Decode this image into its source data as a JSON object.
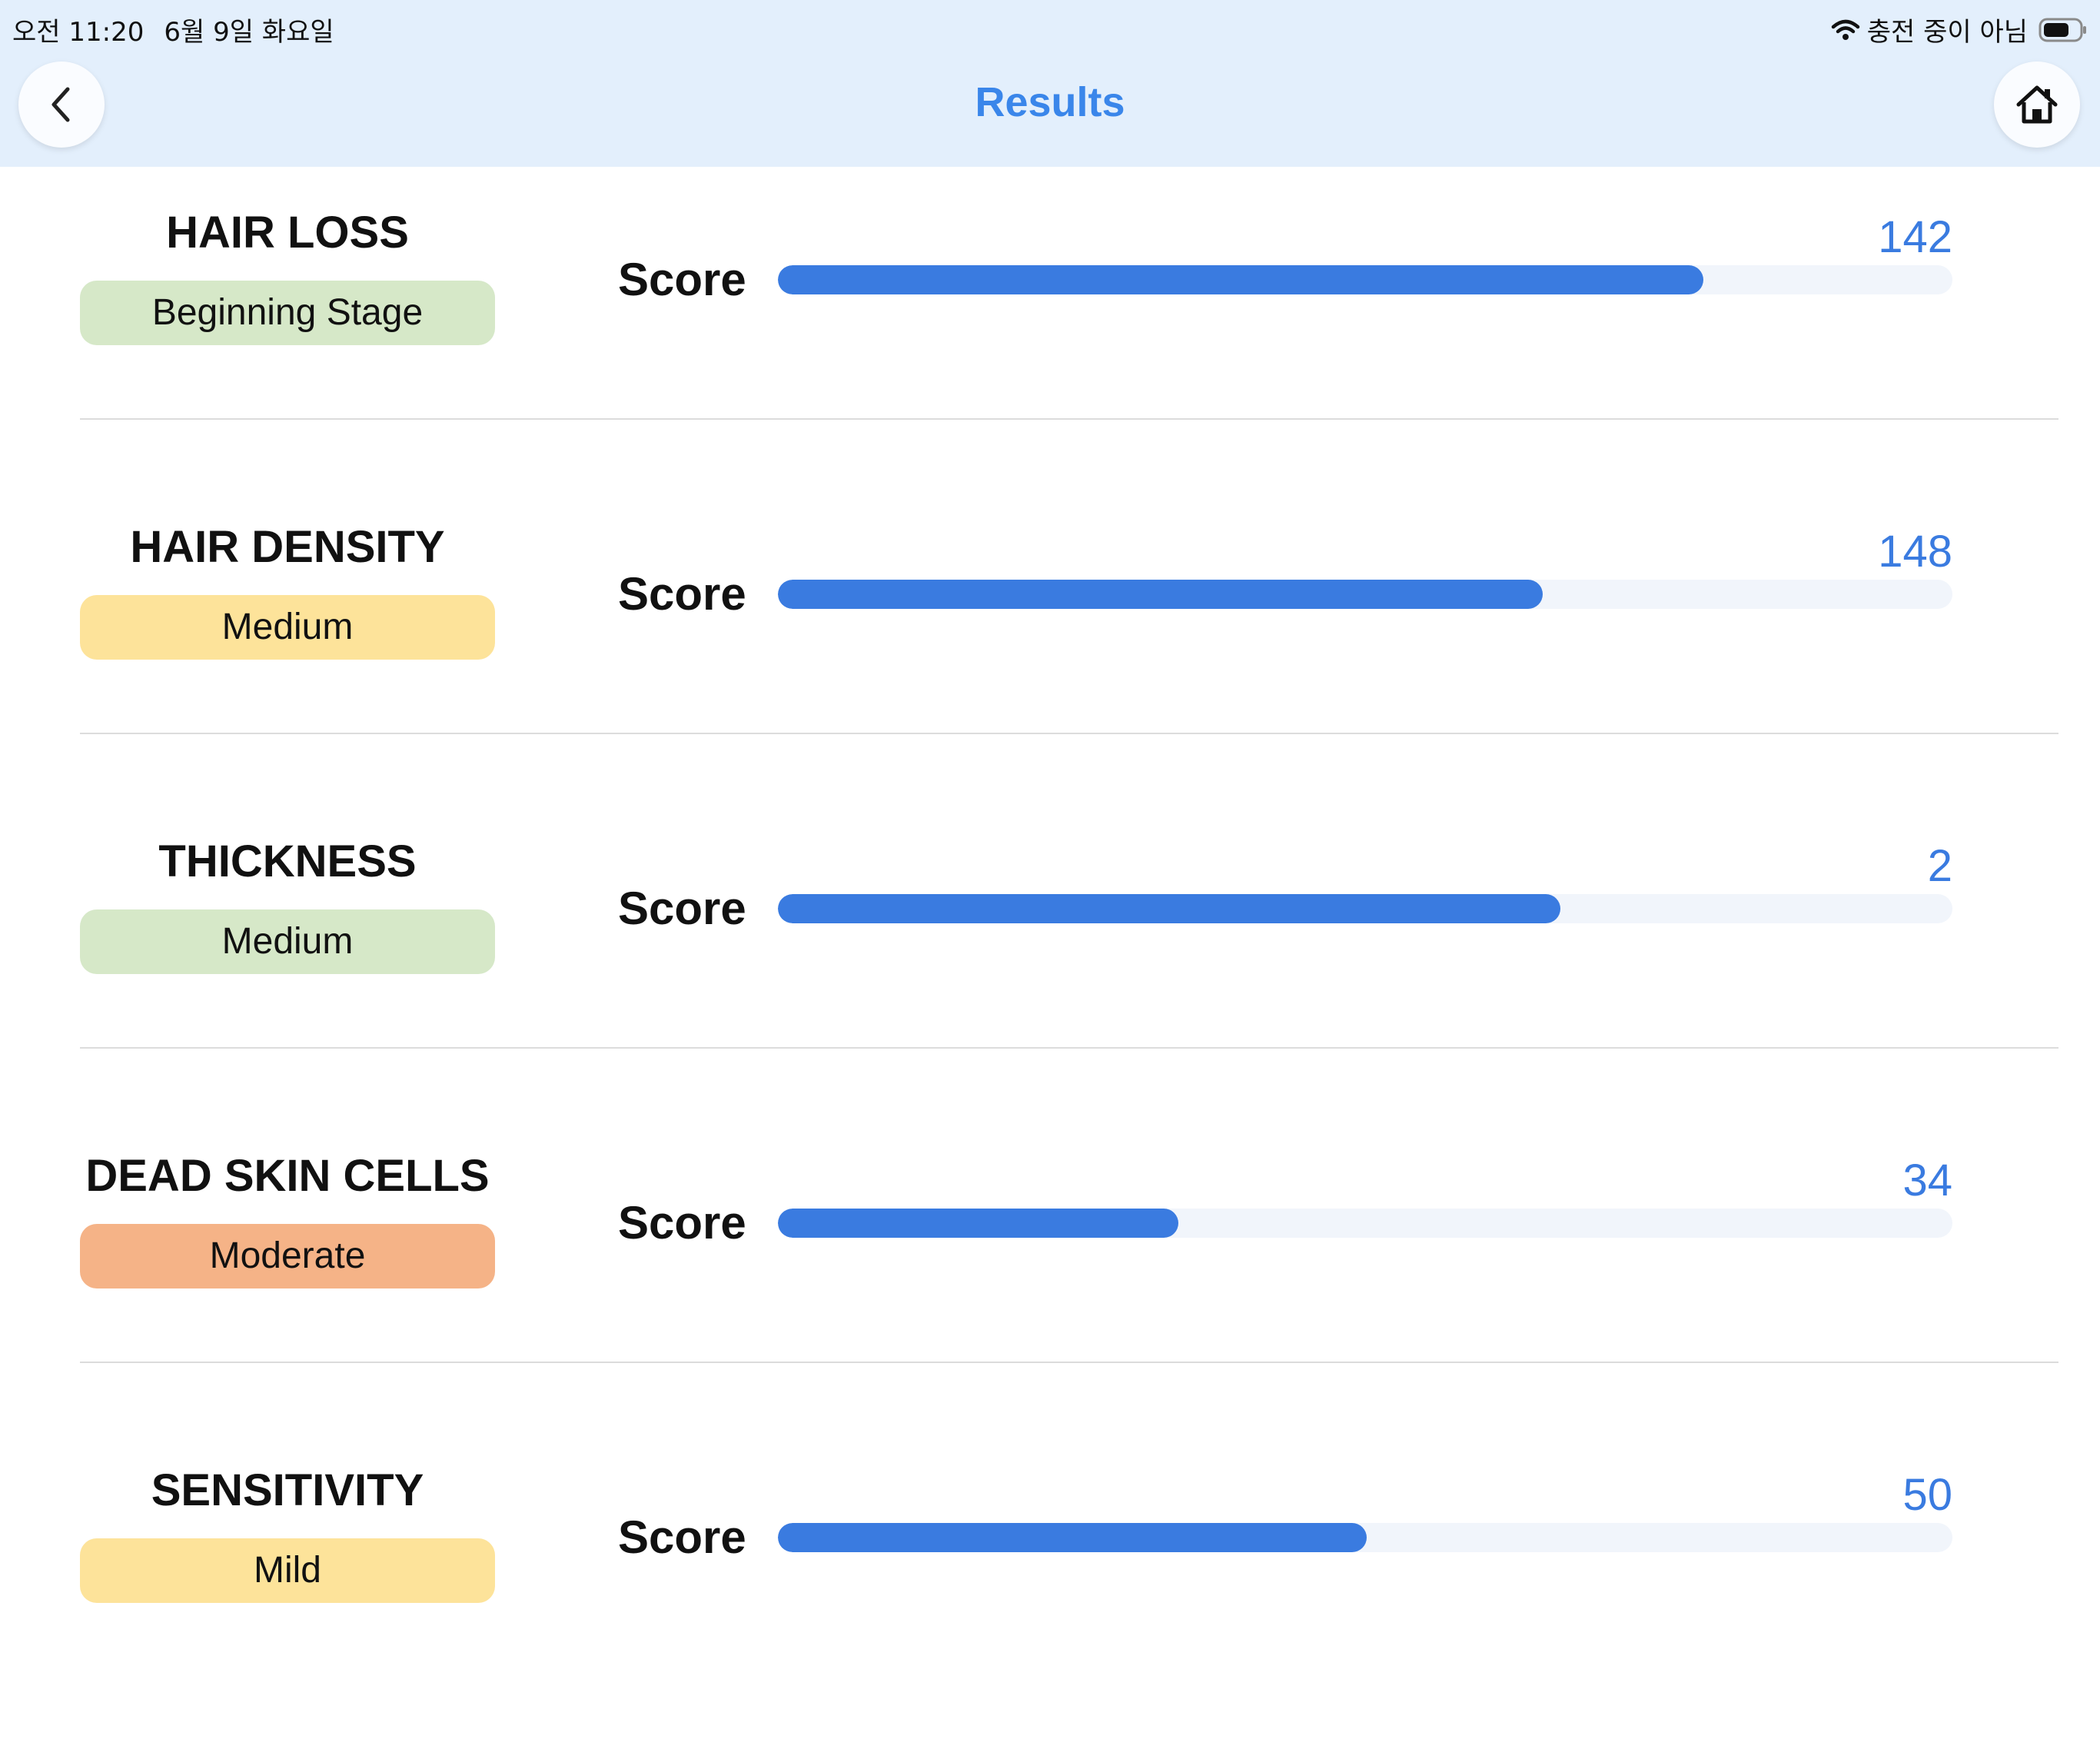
{
  "status_bar": {
    "time": "오전 11:20",
    "date": "6월 9일 화요일",
    "charging": "충전 중이 아님"
  },
  "header": {
    "title": "Results",
    "back_icon": "chevron-left-icon",
    "home_icon": "home-icon"
  },
  "colors": {
    "accent": "#3a7be0",
    "title": "#3a86ea",
    "header_bg": "#e3effc",
    "badge_green": "#d6e8c8",
    "badge_yellow": "#fde39a",
    "badge_orange": "#f5b387"
  },
  "results": [
    {
      "name": "HAIR LOSS",
      "status": "Beginning Stage",
      "badge_color": "#d6e8c8",
      "score_label": "Score",
      "score": "142",
      "fill_fraction": 0.788
    },
    {
      "name": "HAIR DENSITY",
      "status": "Medium",
      "badge_color": "#fde39a",
      "score_label": "Score",
      "score": "148",
      "fill_fraction": 0.651
    },
    {
      "name": "THICKNESS",
      "status": "Medium",
      "badge_color": "#d6e8c8",
      "score_label": "Score",
      "score": "2",
      "fill_fraction": 0.666
    },
    {
      "name": "DEAD SKIN CELLS",
      "status": "Moderate",
      "badge_color": "#f5b387",
      "score_label": "Score",
      "score": "34",
      "fill_fraction": 0.341
    },
    {
      "name": "SENSITIVITY",
      "status": "Mild",
      "badge_color": "#fde39a",
      "score_label": "Score",
      "score": "50",
      "fill_fraction": 0.501
    }
  ]
}
